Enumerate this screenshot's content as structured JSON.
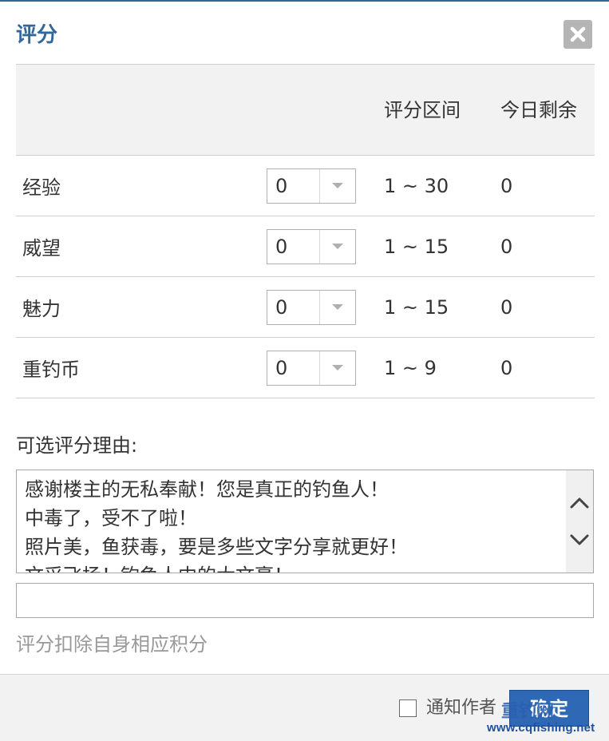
{
  "dialog": {
    "title": "评分",
    "close_icon": "close-icon"
  },
  "table": {
    "headers": {
      "range": "评分区间",
      "remaining": "今日剩余"
    },
    "rows": [
      {
        "label": "经验",
        "value": "0",
        "range": "1 ~ 30",
        "remaining": "0"
      },
      {
        "label": "威望",
        "value": "0",
        "range": "1 ~ 15",
        "remaining": "0"
      },
      {
        "label": "魅力",
        "value": "0",
        "range": "1 ~ 15",
        "remaining": "0"
      },
      {
        "label": "重钓币",
        "value": "0",
        "range": "1 ~ 9",
        "remaining": "0"
      }
    ]
  },
  "reasons": {
    "label": "可选评分理由:",
    "items": [
      "感谢楼主的无私奉献！您是真正的钓鱼人！",
      "中毒了，受不了啦！",
      "照片美，鱼获毒，要是多些文字分享就更好！",
      "文采飞扬！钓鱼人中的大文豪！"
    ],
    "input_value": "",
    "hint": "评分扣除自身相应积分"
  },
  "footer": {
    "notify_label": "通知作者",
    "notify_checked": false,
    "confirm_label": "确定"
  },
  "watermark": {
    "logo": "重钓网",
    "url": "www.cqfishing.net"
  },
  "colors": {
    "accent": "#336699",
    "button": "#2f69b5",
    "hint": "#999999"
  }
}
